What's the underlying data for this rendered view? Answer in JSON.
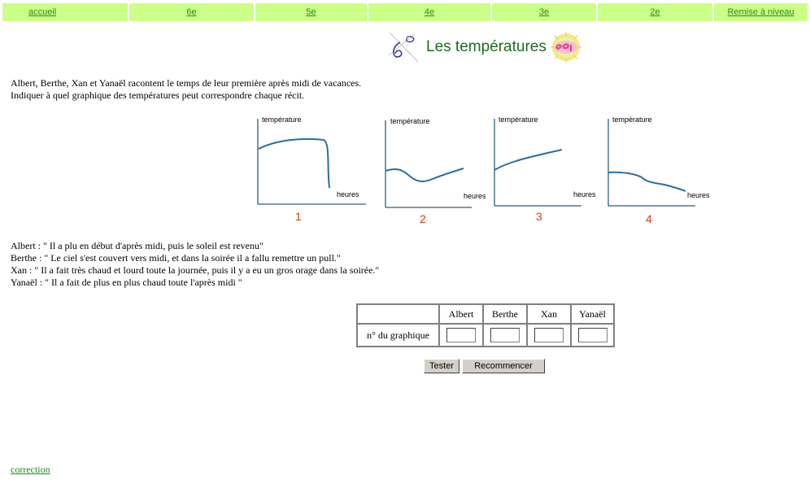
{
  "nav": {
    "items": [
      {
        "label": "accueil"
      },
      {
        "label": "6e"
      },
      {
        "label": "5e"
      },
      {
        "label": "4e"
      },
      {
        "label": "3e"
      },
      {
        "label": "2e"
      },
      {
        "label": "Remise à niveau"
      }
    ]
  },
  "title": "Les températures",
  "intro": {
    "line1": "Albert, Berthe, Xan et Yanaël racontent le temps de leur première après midi de vacances.",
    "line2": "Indiquer à quel graphique des températures peut correspondre chaque récit."
  },
  "graphs": {
    "ylabel": "température",
    "xlabel": "heures",
    "numbers": [
      "1",
      "2",
      "3",
      "4"
    ],
    "curve_color": "#2b6e9a",
    "number_color": "#d33a1e"
  },
  "stories": [
    "Albert : \" Il a plu en début d'après midi, puis le soleil est revenu\"",
    "Berthe : \" Le ciel s'est couvert vers midi, et dans la soirée il a fallu remettre un pull.\"",
    "Xan : \" Il a fait très chaud et lourd toute la journée, puis il y a eu un gros orage dans la soirée.\"",
    "Yanaël : \" Il a fait de plus en plus chaud toute l'après midi \""
  ],
  "table": {
    "headers": [
      "Albert",
      "Berthe",
      "Xan",
      "Yanaël"
    ],
    "row_label": "n° du graphique",
    "values": [
      "",
      "",
      "",
      ""
    ]
  },
  "buttons": {
    "test": "Tester",
    "reset": "Recommencer"
  },
  "footer": {
    "correction": "correction"
  },
  "colors": {
    "nav_bg": "#ccff88",
    "link": "#2a8a16",
    "title": "#1e6b1e"
  }
}
